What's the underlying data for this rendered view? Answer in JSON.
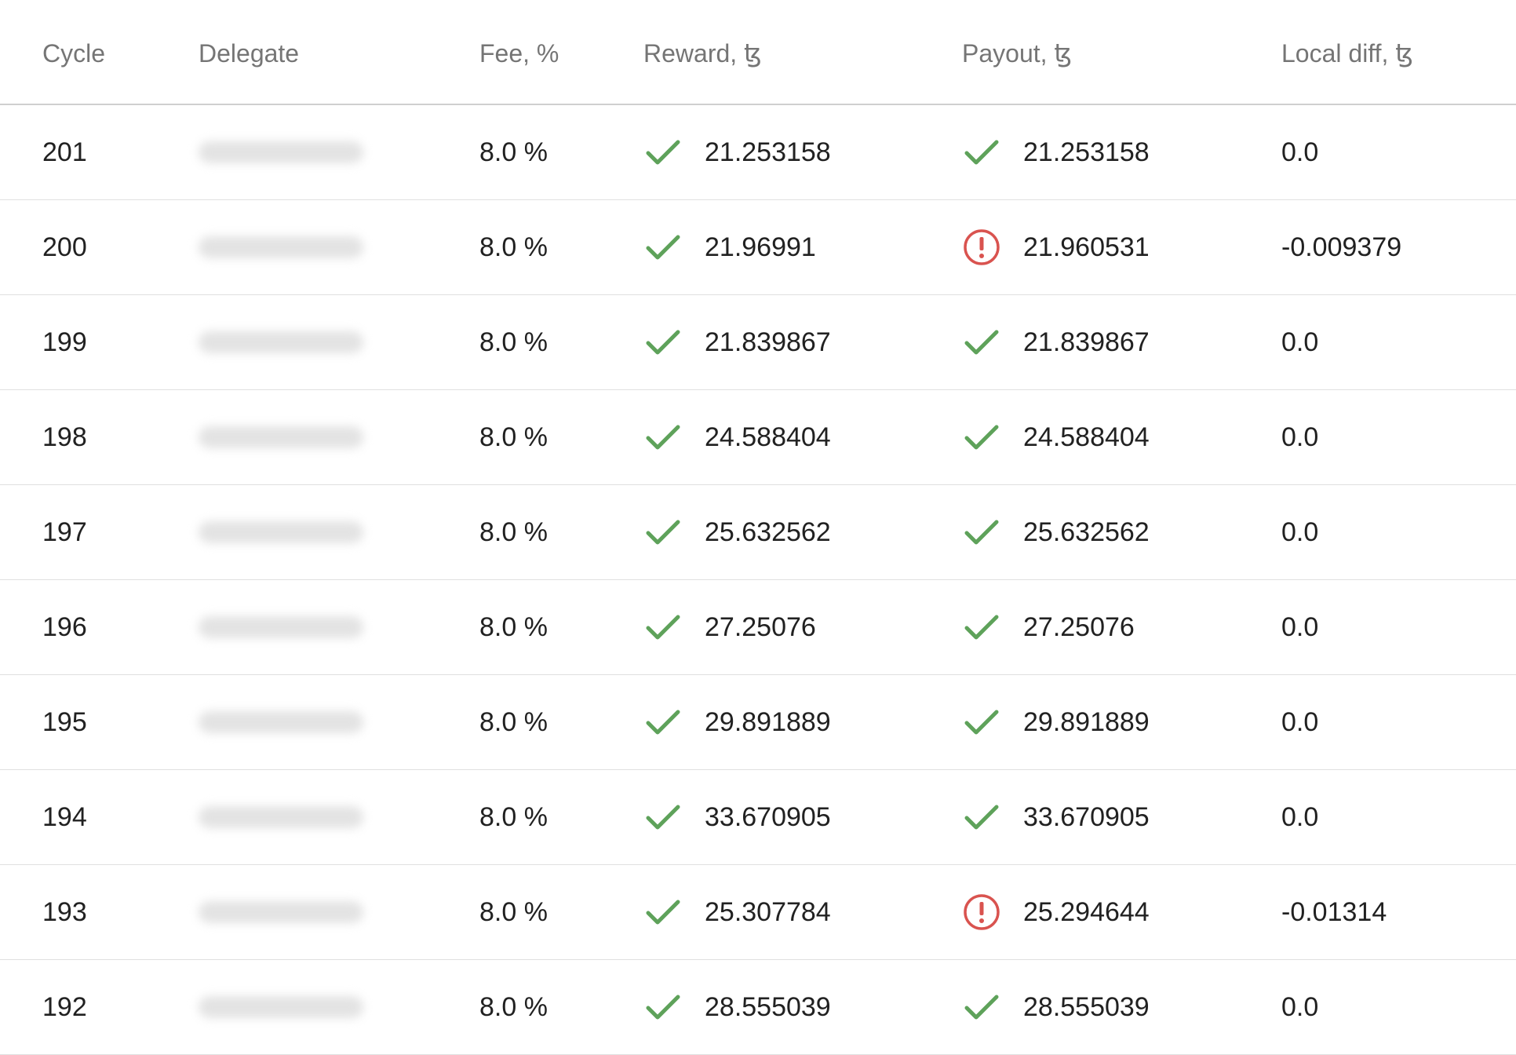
{
  "table": {
    "headers": {
      "cycle": "Cycle",
      "delegate": "Delegate",
      "fee": "Fee, %",
      "reward": "Reward, ꜩ",
      "payout": "Payout, ꜩ",
      "local_diff": "Local diff, ꜩ"
    },
    "rows": [
      {
        "cycle": "201",
        "delegate": "",
        "fee": "8.0 %",
        "reward": "21.253158",
        "reward_status": "check-icon",
        "payout": "21.253158",
        "payout_status": "check-icon",
        "local_diff": "0.0"
      },
      {
        "cycle": "200",
        "delegate": "",
        "fee": "8.0 %",
        "reward": "21.96991",
        "reward_status": "check-icon",
        "payout": "21.960531",
        "payout_status": "alert-icon",
        "local_diff": "-0.009379"
      },
      {
        "cycle": "199",
        "delegate": "",
        "fee": "8.0 %",
        "reward": "21.839867",
        "reward_status": "check-icon",
        "payout": "21.839867",
        "payout_status": "check-icon",
        "local_diff": "0.0"
      },
      {
        "cycle": "198",
        "delegate": "",
        "fee": "8.0 %",
        "reward": "24.588404",
        "reward_status": "check-icon",
        "payout": "24.588404",
        "payout_status": "check-icon",
        "local_diff": "0.0"
      },
      {
        "cycle": "197",
        "delegate": "",
        "fee": "8.0 %",
        "reward": "25.632562",
        "reward_status": "check-icon",
        "payout": "25.632562",
        "payout_status": "check-icon",
        "local_diff": "0.0"
      },
      {
        "cycle": "196",
        "delegate": "",
        "fee": "8.0 %",
        "reward": "27.25076",
        "reward_status": "check-icon",
        "payout": "27.25076",
        "payout_status": "check-icon",
        "local_diff": "0.0"
      },
      {
        "cycle": "195",
        "delegate": "",
        "fee": "8.0 %",
        "reward": "29.891889",
        "reward_status": "check-icon",
        "payout": "29.891889",
        "payout_status": "check-icon",
        "local_diff": "0.0"
      },
      {
        "cycle": "194",
        "delegate": "",
        "fee": "8.0 %",
        "reward": "33.670905",
        "reward_status": "check-icon",
        "payout": "33.670905",
        "payout_status": "check-icon",
        "local_diff": "0.0"
      },
      {
        "cycle": "193",
        "delegate": "",
        "fee": "8.0 %",
        "reward": "25.307784",
        "reward_status": "check-icon",
        "payout": "25.294644",
        "payout_status": "alert-icon",
        "local_diff": "-0.01314"
      },
      {
        "cycle": "192",
        "delegate": "",
        "fee": "8.0 %",
        "reward": "28.555039",
        "reward_status": "check-icon",
        "payout": "28.555039",
        "payout_status": "check-icon",
        "local_diff": "0.0"
      }
    ]
  },
  "colors": {
    "success": "#5ea25a",
    "error": "#d9534f",
    "header_text": "#757575",
    "body_text": "#212121",
    "divider": "#e0e0e0"
  }
}
